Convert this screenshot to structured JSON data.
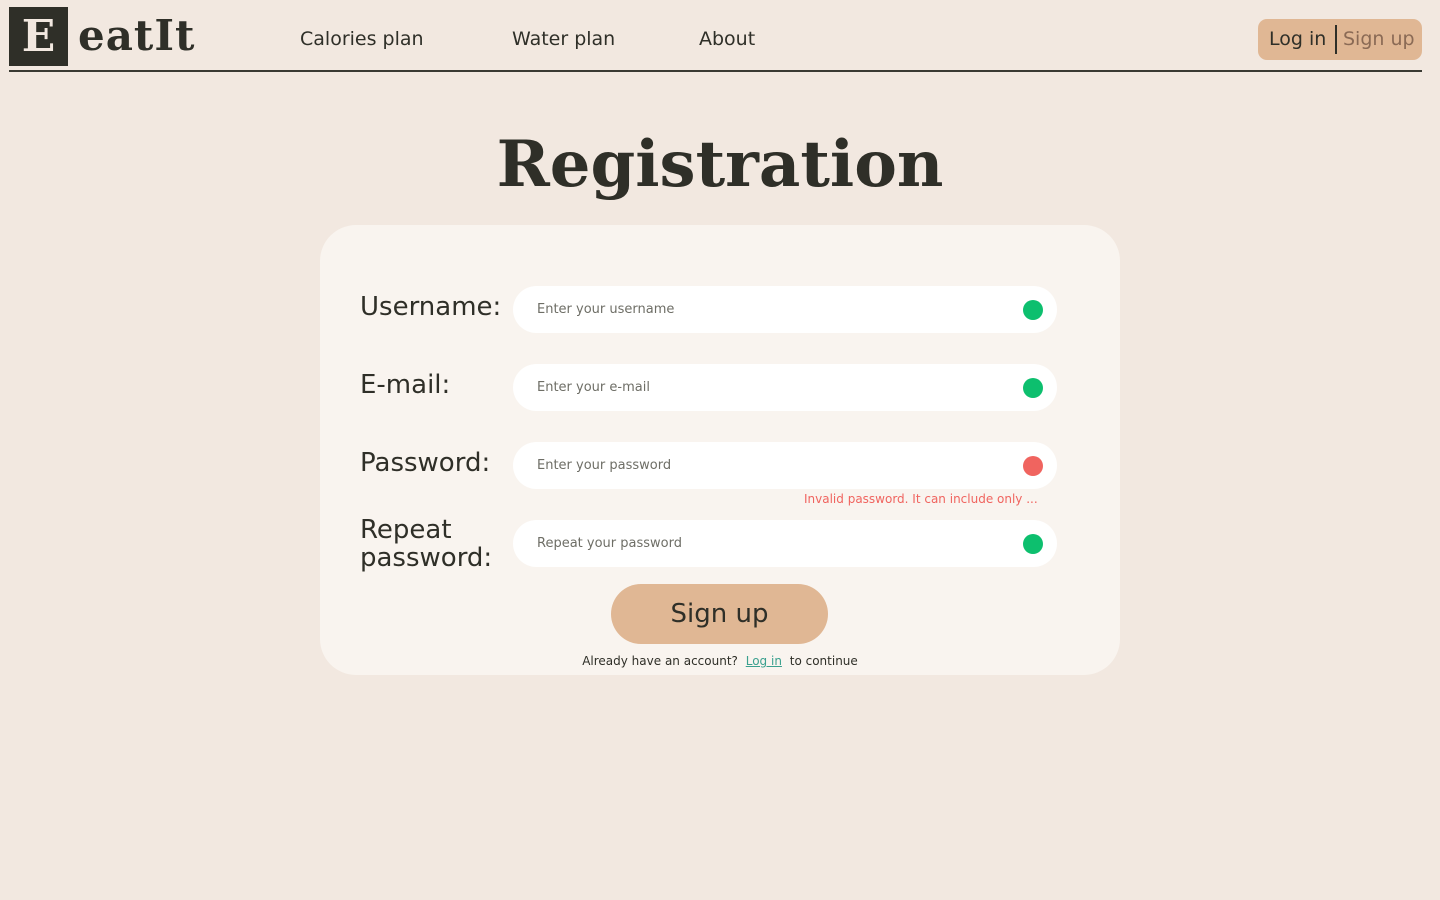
{
  "header": {
    "logo_letter": "E",
    "logo_text": "eatIt",
    "nav": {
      "calories": "Calories plan",
      "water": "Water plan",
      "about": "About"
    },
    "auth": {
      "login": "Log in",
      "signup": "Sign up"
    }
  },
  "title": "Registration",
  "form": {
    "username": {
      "label": "Username:",
      "placeholder": "Enter your username",
      "status": "valid"
    },
    "email": {
      "label": "E-mail:",
      "placeholder": "Enter your e-mail",
      "status": "valid"
    },
    "password": {
      "label": "Password:",
      "placeholder": "Enter your password",
      "status": "invalid",
      "error": "Invalid password. It can include only ..."
    },
    "repeat": {
      "label_line1": "Repeat",
      "label_line2": "password:",
      "placeholder": "Repeat your password",
      "status": "valid"
    },
    "submit_label": "Sign up",
    "footer": {
      "prefix": "Already have an account?",
      "link": "Log in",
      "suffix": "to continue"
    }
  },
  "colors": {
    "background": "#f2e8e0",
    "card": "#f9f4ef",
    "accent": "#e0b794",
    "valid": "#0dbf6e",
    "invalid": "#f0645f",
    "link": "#3aa08e"
  }
}
